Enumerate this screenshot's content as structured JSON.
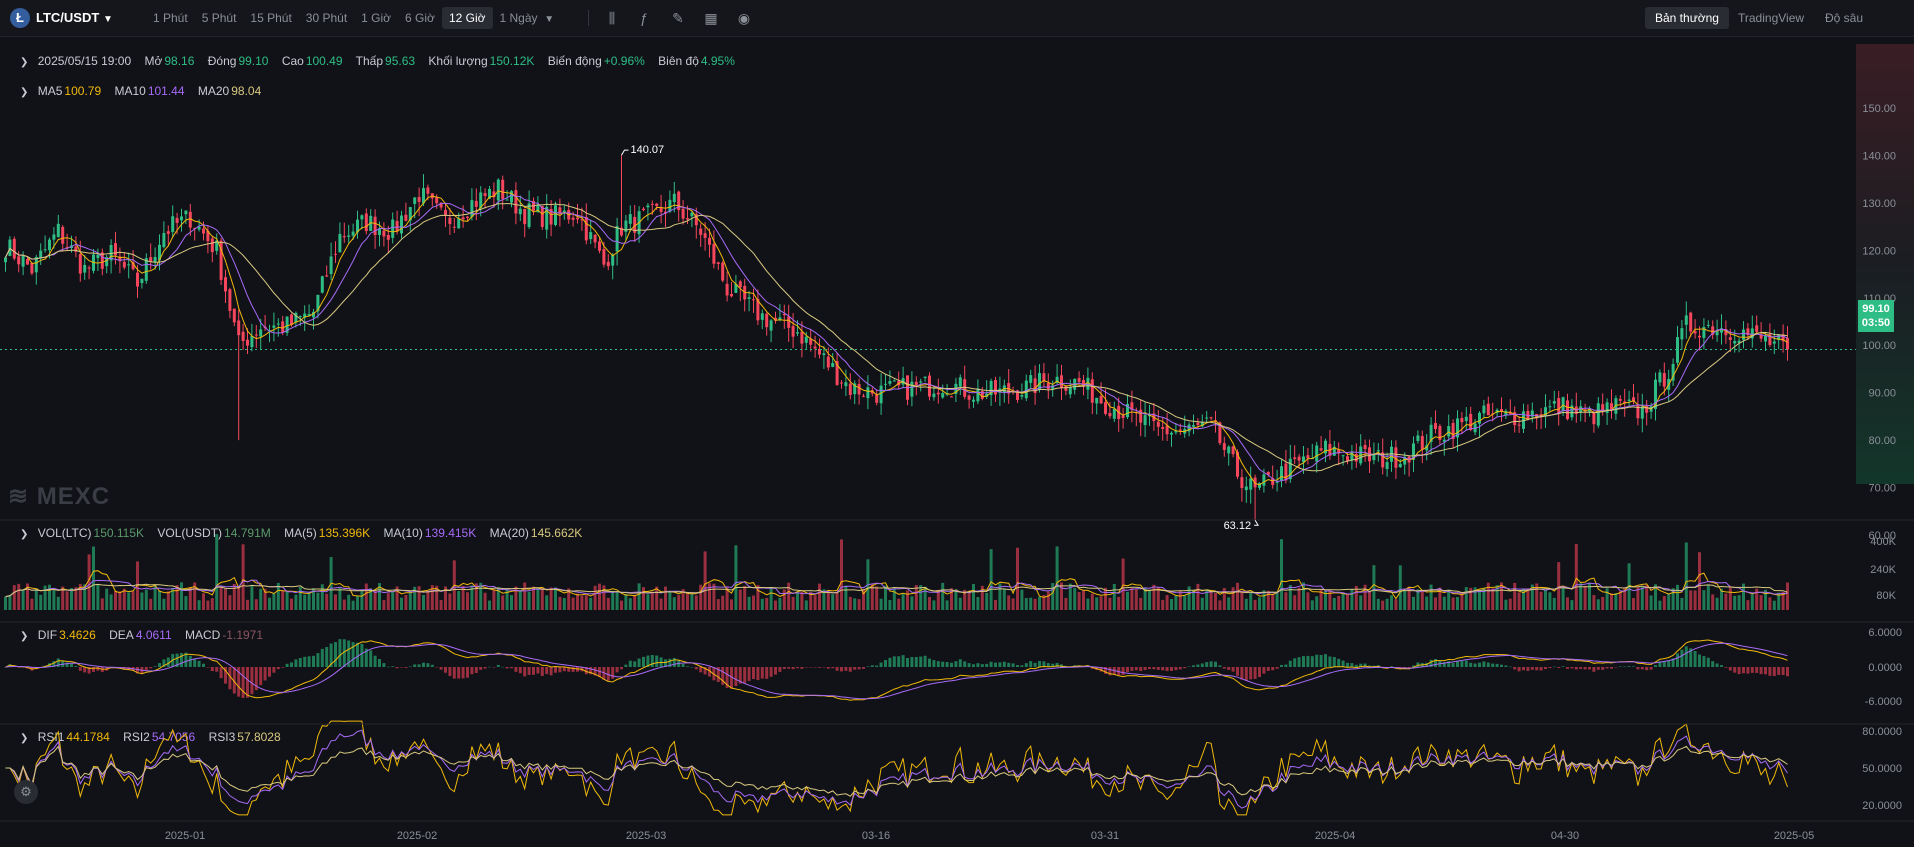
{
  "topbar": {
    "coin_icon": "litecoin-icon",
    "pair": "LTC/USDT",
    "timeframes": [
      "1 Phút",
      "5 Phút",
      "15 Phút",
      "30 Phút",
      "1 Giờ",
      "6 Giờ",
      "12 Giờ",
      "1 Ngày"
    ],
    "active_timeframe": "12 Giờ",
    "tools": [
      "candles-icon",
      "indicator-icon",
      "draw-icon",
      "layout-icon",
      "camera-icon"
    ],
    "views": [
      "Bản thường",
      "TradingView",
      "Độ sâu"
    ],
    "active_view": "Bản thường"
  },
  "ohlc": {
    "date": "2025/05/15 19:00",
    "open_label": "Mở",
    "open": "98.16",
    "close_label": "Đóng",
    "close": "99.10",
    "high_label": "Cao",
    "high": "100.49",
    "low_label": "Thấp",
    "low": "95.63",
    "volume_label": "Khối lượng",
    "volume": "150.12K",
    "change_label": "Biến động",
    "change": "+0.96%",
    "amplitude_label": "Biên độ",
    "amplitude": "4.95%"
  },
  "ma": {
    "ma5_label": "MA5",
    "ma5": "100.79",
    "ma10_label": "MA10",
    "ma10": "101.44",
    "ma20_label": "MA20",
    "ma20": "98.04"
  },
  "vol": {
    "vol_ltc_label": "VOL(LTC)",
    "vol_ltc": "150.115K",
    "vol_usdt_label": "VOL(USDT)",
    "vol_usdt": "14.791M",
    "ma5_label": "MA(5)",
    "ma5": "135.396K",
    "ma10_label": "MA(10)",
    "ma10": "139.415K",
    "ma20_label": "MA(20)",
    "ma20": "145.662K"
  },
  "macd": {
    "dif_label": "DIF",
    "dif": "3.4626",
    "dea_label": "DEA",
    "dea": "4.0611",
    "macd_label": "MACD",
    "macd": "-1.1971"
  },
  "rsi": {
    "rsi1_label": "RSI1",
    "rsi1": "44.1784",
    "rsi2_label": "RSI2",
    "rsi2": "54.7056",
    "rsi3_label": "RSI3",
    "rsi3": "57.8028"
  },
  "price_tag": {
    "price": "99.10",
    "countdown": "03:50"
  },
  "watermark": "MEXC",
  "colors": {
    "up": "#2ebd85",
    "down": "#f6465d",
    "ma5": "#f0b90b",
    "ma10": "#a66bf7",
    "ma20": "#d8c880",
    "bg": "#111217"
  },
  "chart_data": {
    "type": "candlestick",
    "price_axis": {
      "ticks": [
        "150.00",
        "140.00",
        "130.00",
        "120.00",
        "110.00",
        "100.00",
        "90.00",
        "80.00",
        "70.00",
        "60.00"
      ],
      "ylim": [
        57,
        153
      ]
    },
    "volume_axis": {
      "ticks": [
        "400K",
        "240K",
        "80K"
      ]
    },
    "macd_axis": {
      "ticks": [
        "6.0000",
        "0.0000",
        "-6.0000"
      ]
    },
    "rsi_axis": {
      "ticks": [
        "80.0000",
        "50.0000",
        "20.0000"
      ]
    },
    "x_ticks": [
      "2025-01",
      "2025-02",
      "2025-03",
      "03-16",
      "03-31",
      "2025-04",
      "04-30",
      "2025-05"
    ],
    "max_label": "140.07",
    "min_label": "63.12",
    "keypoints": [
      [
        0,
        121
      ],
      [
        6,
        116
      ],
      [
        12,
        124
      ],
      [
        18,
        116
      ],
      [
        24,
        119
      ],
      [
        30,
        113
      ],
      [
        36,
        124
      ],
      [
        42,
        127
      ],
      [
        48,
        120
      ],
      [
        53,
        100
      ],
      [
        58,
        104
      ],
      [
        64,
        104
      ],
      [
        70,
        107
      ],
      [
        76,
        123
      ],
      [
        82,
        126
      ],
      [
        88,
        124
      ],
      [
        94,
        132
      ],
      [
        100,
        126
      ],
      [
        106,
        130
      ],
      [
        112,
        133
      ],
      [
        118,
        128
      ],
      [
        124,
        127
      ],
      [
        130,
        128
      ],
      [
        136,
        117
      ],
      [
        140,
        125
      ],
      [
        146,
        127
      ],
      [
        152,
        130
      ],
      [
        158,
        124
      ],
      [
        164,
        112
      ],
      [
        172,
        106
      ],
      [
        180,
        103
      ],
      [
        186,
        97
      ],
      [
        192,
        91
      ],
      [
        198,
        90
      ],
      [
        206,
        91
      ],
      [
        214,
        92
      ],
      [
        220,
        90
      ],
      [
        226,
        90
      ],
      [
        232,
        91
      ],
      [
        238,
        93
      ],
      [
        244,
        92
      ],
      [
        250,
        88
      ],
      [
        256,
        85
      ],
      [
        262,
        82
      ],
      [
        268,
        82
      ],
      [
        274,
        83
      ],
      [
        280,
        73
      ],
      [
        284,
        69
      ],
      [
        288,
        72
      ],
      [
        294,
        75
      ],
      [
        300,
        78
      ],
      [
        306,
        77
      ],
      [
        312,
        76
      ],
      [
        318,
        77
      ],
      [
        324,
        81
      ],
      [
        330,
        83
      ],
      [
        336,
        85
      ],
      [
        342,
        85
      ],
      [
        348,
        86
      ],
      [
        354,
        87
      ],
      [
        360,
        85
      ],
      [
        366,
        87
      ],
      [
        372,
        86
      ],
      [
        378,
        95
      ],
      [
        382,
        104
      ],
      [
        388,
        104
      ],
      [
        394,
        103
      ],
      [
        400,
        101
      ],
      [
        405,
        99.1
      ]
    ]
  }
}
